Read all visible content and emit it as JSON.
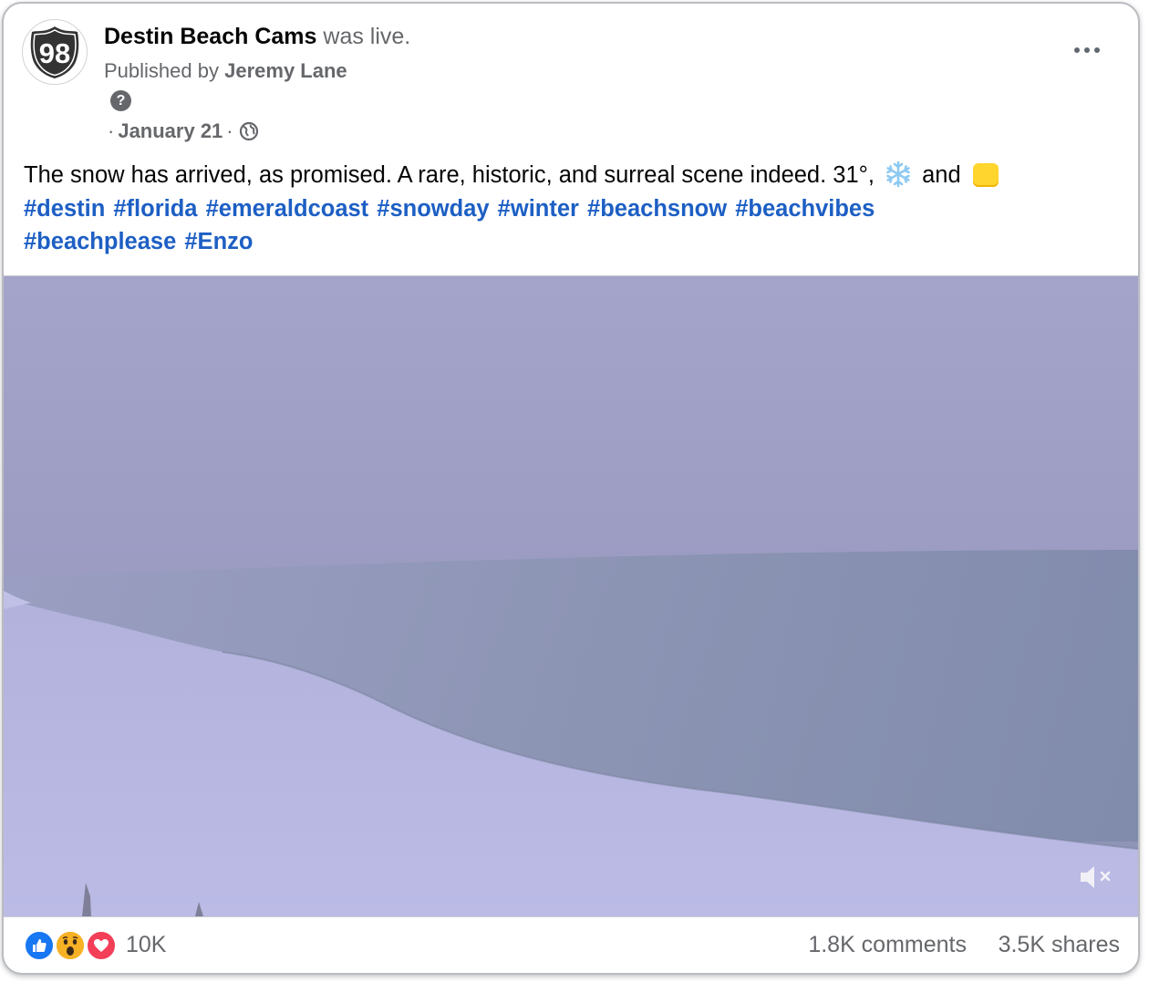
{
  "post": {
    "page_name": "Destin Beach Cams",
    "activity": "was live.",
    "published_by_prefix": "Published by",
    "publisher_name": "Jeremy Lane",
    "help_glyph": "?",
    "date_sep": "·",
    "date": "January 21",
    "audience_icon": "globe-icon",
    "avatar_text": "98",
    "more_icon": "more-options-icon"
  },
  "caption": {
    "text_before": "The snow has arrived, as promised. A rare, historic, and surreal scene indeed. 31°,",
    "text_and": "and",
    "emoji_1": "snowflake-emoji",
    "emoji_2": "yellow-square-emoji",
    "hashtags": [
      "#destin",
      "#florida",
      "#emeraldcoast",
      "#snowday",
      "#winter",
      "#beachsnow",
      "#beachvibes",
      "#beachplease",
      "#Enzo"
    ]
  },
  "video": {
    "mute_icon": "muted-speaker-icon"
  },
  "footer": {
    "reaction_icons": [
      "like-icon",
      "wow-icon",
      "love-icon"
    ],
    "reaction_count": "10K",
    "comments": "1.8K comments",
    "shares": "3.5K shares"
  },
  "colors": {
    "link": "#1d5fc4",
    "secondary_text": "#65676b",
    "like_blue": "#1877f2",
    "love_red": "#f33e58",
    "wow_yellow": "#f7b125"
  }
}
